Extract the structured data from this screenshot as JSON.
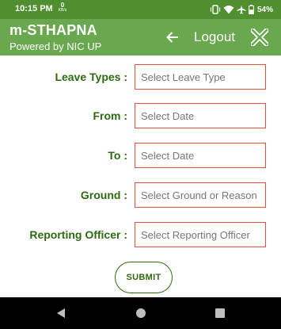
{
  "status_bar": {
    "time": "10:15 PM",
    "net_speed": "0",
    "net_unit": "KB/s",
    "battery": "54%",
    "icons": [
      "vibrate-icon",
      "wifi-icon",
      "airplane-icon",
      "battery-icon"
    ]
  },
  "app_bar": {
    "title": "m-STHAPNA",
    "subtitle": "Powered by NIC UP",
    "logout_label": "Logout",
    "back_icon": "back-arrow-icon",
    "close_icon": "close-icon",
    "color": "#6aa84f"
  },
  "form": {
    "fields": [
      {
        "label": "Leave Types :",
        "placeholder": "Select Leave Type"
      },
      {
        "label": "From :",
        "placeholder": "Select Date"
      },
      {
        "label": "To :",
        "placeholder": "Select Date"
      },
      {
        "label": "Ground :",
        "placeholder": "Select Ground or Reason"
      },
      {
        "label": "Reporting Officer :",
        "placeholder": "Select Reporting Officer"
      }
    ],
    "submit_label": "SUBMIT",
    "label_color": "#2e6b10",
    "input_border_color": "#e2513f"
  },
  "nav_bar": {
    "icons": [
      "nav-back-icon",
      "nav-home-icon",
      "nav-recents-icon"
    ]
  }
}
